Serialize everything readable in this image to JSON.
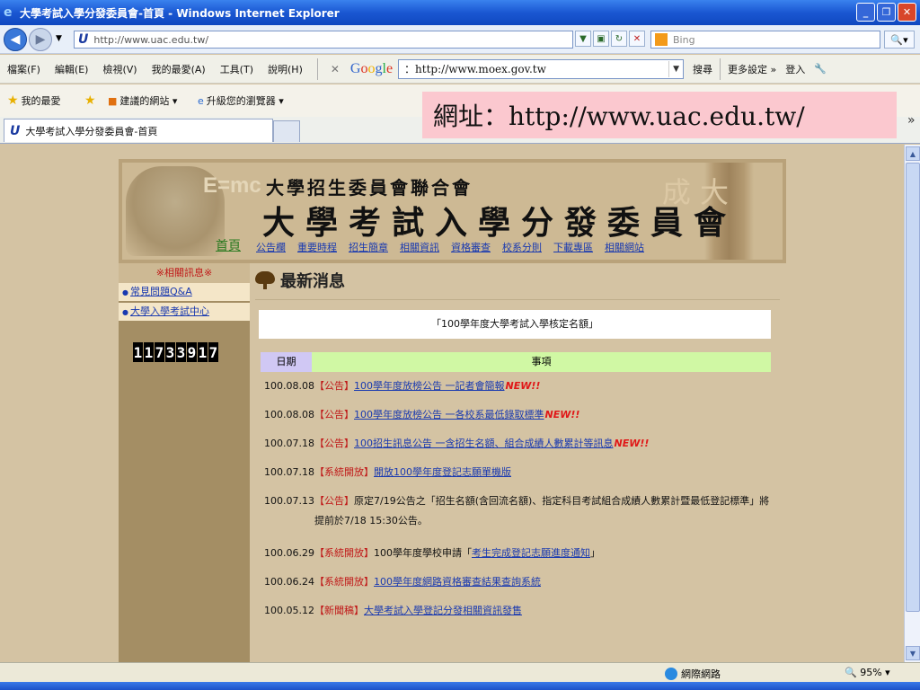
{
  "window": {
    "title": "大學考試入學分發委員會-首頁 - Windows Internet Explorer"
  },
  "address": {
    "url": "http://www.uac.edu.tw/",
    "search_placeholder": "Bing"
  },
  "menu": {
    "items": [
      "檔案(F)",
      "編輯(E)",
      "檢視(V)",
      "我的最愛(A)",
      "工具(T)",
      "說明(H)"
    ]
  },
  "google_toolbar": {
    "search_value": "：http://www.moex.gov.tw",
    "search_label": "搜尋",
    "more_label": "更多設定 »",
    "login_label": "登入"
  },
  "favorites": {
    "favorites_label": "我的最愛",
    "suggested_label": "建議的網站 ▾",
    "upgrade_label": "升級您的瀏覽器 ▾"
  },
  "tab": {
    "label": "大學考試入學分發委員會-首頁"
  },
  "annotation": {
    "text": "網址：http://www.uac.edu.tw/"
  },
  "banner": {
    "title_small": "大學招生委員會聯合會",
    "title_large": "大學考試入學分發委員會",
    "emc": "E=mc",
    "ghost_text": "成 大"
  },
  "nav": {
    "home": "首頁",
    "items": [
      "公告欄",
      "重要時程",
      "招生簡章",
      "相關資訊",
      "資格審查",
      "校系分則",
      "下載專區",
      "相關網站"
    ]
  },
  "sidebar": {
    "heading": "※相關訊息※",
    "links": [
      "常見問題Q&A",
      "大學入學考試中心"
    ],
    "counter": "11733917"
  },
  "news": {
    "heading": "最新消息",
    "notice": "「100學年度大學考試入學核定名額」",
    "col_date": "日期",
    "col_item": "事項",
    "rows": [
      {
        "date": "100.08.08",
        "tag": "【公告】",
        "link": "100學年度放榜公告 一記者會簡報",
        "new": "NEW!!",
        "text": ""
      },
      {
        "date": "100.08.08",
        "tag": "【公告】",
        "link": "100學年度放榜公告 一各校系最低錄取標準",
        "new": "NEW!!",
        "text": ""
      },
      {
        "date": "100.07.18",
        "tag": "【公告】",
        "link": "100招生訊息公告 一含招生名額、組合成績人數累計等訊息",
        "new": "NEW!!",
        "text": ""
      },
      {
        "date": "100.07.18",
        "tag": "【系統開放】",
        "link": "開放100學年度登記志願單機版",
        "new": "",
        "text": ""
      },
      {
        "date": "100.07.13",
        "tag": "【公告】",
        "link": "",
        "new": "",
        "text": "原定7/19公告之「招生名額(含回流名額)、指定科目考試組合成績人數累計暨最低登記標準」將提前於7/18  15:30公告。"
      },
      {
        "date": "100.06.29",
        "tag": "【系統開放】",
        "link": "考生完成登記志願進度通知",
        "new": "",
        "text": "100學年度學校申請「",
        "suffix": "」"
      },
      {
        "date": "100.06.24",
        "tag": "【系統開放】",
        "link": "100學年度網路資格審查結果查詢系統",
        "new": "",
        "text": ""
      },
      {
        "date": "100.05.12",
        "tag": "【新聞稿】",
        "link": "大學考試入學登記分發相關資訊發售",
        "new": "",
        "text": ""
      }
    ]
  },
  "status": {
    "zone": "網際網路",
    "zoom": "95%"
  }
}
